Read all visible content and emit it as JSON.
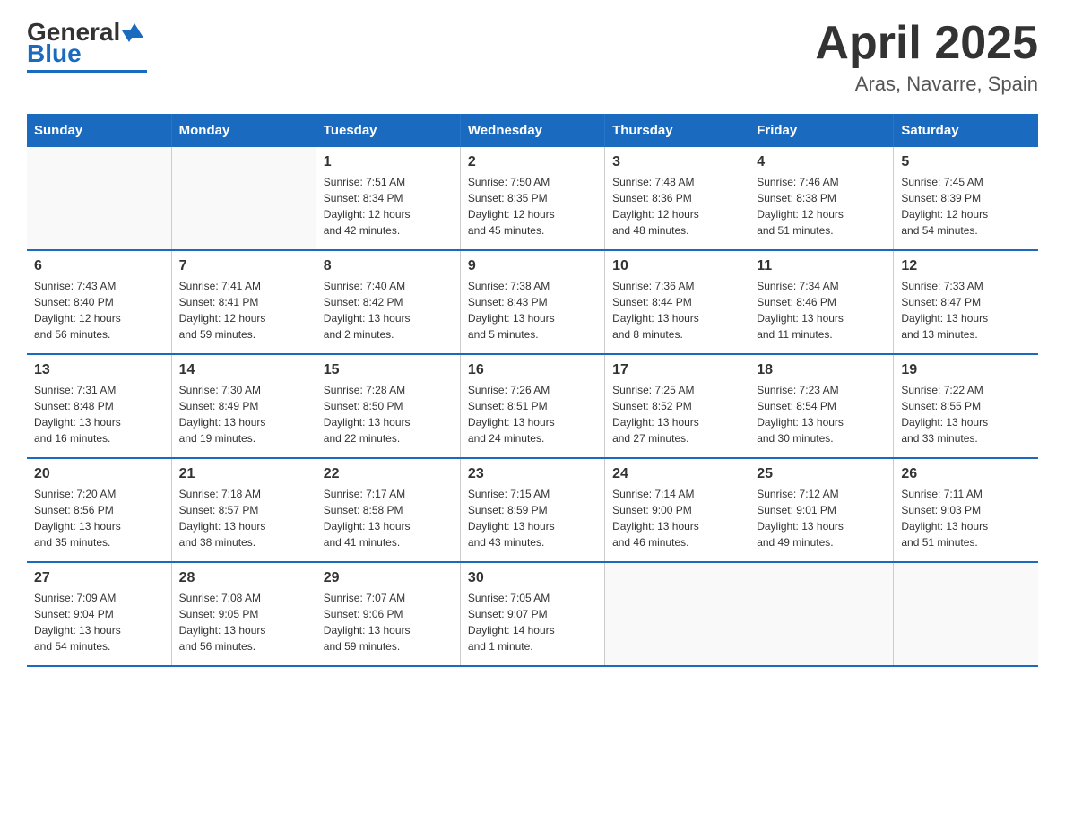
{
  "logo": {
    "general": "General",
    "blue": "Blue"
  },
  "title": {
    "month": "April 2025",
    "location": "Aras, Navarre, Spain"
  },
  "weekdays": [
    "Sunday",
    "Monday",
    "Tuesday",
    "Wednesday",
    "Thursday",
    "Friday",
    "Saturday"
  ],
  "weeks": [
    [
      {
        "day": "",
        "info": ""
      },
      {
        "day": "",
        "info": ""
      },
      {
        "day": "1",
        "info": "Sunrise: 7:51 AM\nSunset: 8:34 PM\nDaylight: 12 hours\nand 42 minutes."
      },
      {
        "day": "2",
        "info": "Sunrise: 7:50 AM\nSunset: 8:35 PM\nDaylight: 12 hours\nand 45 minutes."
      },
      {
        "day": "3",
        "info": "Sunrise: 7:48 AM\nSunset: 8:36 PM\nDaylight: 12 hours\nand 48 minutes."
      },
      {
        "day": "4",
        "info": "Sunrise: 7:46 AM\nSunset: 8:38 PM\nDaylight: 12 hours\nand 51 minutes."
      },
      {
        "day": "5",
        "info": "Sunrise: 7:45 AM\nSunset: 8:39 PM\nDaylight: 12 hours\nand 54 minutes."
      }
    ],
    [
      {
        "day": "6",
        "info": "Sunrise: 7:43 AM\nSunset: 8:40 PM\nDaylight: 12 hours\nand 56 minutes."
      },
      {
        "day": "7",
        "info": "Sunrise: 7:41 AM\nSunset: 8:41 PM\nDaylight: 12 hours\nand 59 minutes."
      },
      {
        "day": "8",
        "info": "Sunrise: 7:40 AM\nSunset: 8:42 PM\nDaylight: 13 hours\nand 2 minutes."
      },
      {
        "day": "9",
        "info": "Sunrise: 7:38 AM\nSunset: 8:43 PM\nDaylight: 13 hours\nand 5 minutes."
      },
      {
        "day": "10",
        "info": "Sunrise: 7:36 AM\nSunset: 8:44 PM\nDaylight: 13 hours\nand 8 minutes."
      },
      {
        "day": "11",
        "info": "Sunrise: 7:34 AM\nSunset: 8:46 PM\nDaylight: 13 hours\nand 11 minutes."
      },
      {
        "day": "12",
        "info": "Sunrise: 7:33 AM\nSunset: 8:47 PM\nDaylight: 13 hours\nand 13 minutes."
      }
    ],
    [
      {
        "day": "13",
        "info": "Sunrise: 7:31 AM\nSunset: 8:48 PM\nDaylight: 13 hours\nand 16 minutes."
      },
      {
        "day": "14",
        "info": "Sunrise: 7:30 AM\nSunset: 8:49 PM\nDaylight: 13 hours\nand 19 minutes."
      },
      {
        "day": "15",
        "info": "Sunrise: 7:28 AM\nSunset: 8:50 PM\nDaylight: 13 hours\nand 22 minutes."
      },
      {
        "day": "16",
        "info": "Sunrise: 7:26 AM\nSunset: 8:51 PM\nDaylight: 13 hours\nand 24 minutes."
      },
      {
        "day": "17",
        "info": "Sunrise: 7:25 AM\nSunset: 8:52 PM\nDaylight: 13 hours\nand 27 minutes."
      },
      {
        "day": "18",
        "info": "Sunrise: 7:23 AM\nSunset: 8:54 PM\nDaylight: 13 hours\nand 30 minutes."
      },
      {
        "day": "19",
        "info": "Sunrise: 7:22 AM\nSunset: 8:55 PM\nDaylight: 13 hours\nand 33 minutes."
      }
    ],
    [
      {
        "day": "20",
        "info": "Sunrise: 7:20 AM\nSunset: 8:56 PM\nDaylight: 13 hours\nand 35 minutes."
      },
      {
        "day": "21",
        "info": "Sunrise: 7:18 AM\nSunset: 8:57 PM\nDaylight: 13 hours\nand 38 minutes."
      },
      {
        "day": "22",
        "info": "Sunrise: 7:17 AM\nSunset: 8:58 PM\nDaylight: 13 hours\nand 41 minutes."
      },
      {
        "day": "23",
        "info": "Sunrise: 7:15 AM\nSunset: 8:59 PM\nDaylight: 13 hours\nand 43 minutes."
      },
      {
        "day": "24",
        "info": "Sunrise: 7:14 AM\nSunset: 9:00 PM\nDaylight: 13 hours\nand 46 minutes."
      },
      {
        "day": "25",
        "info": "Sunrise: 7:12 AM\nSunset: 9:01 PM\nDaylight: 13 hours\nand 49 minutes."
      },
      {
        "day": "26",
        "info": "Sunrise: 7:11 AM\nSunset: 9:03 PM\nDaylight: 13 hours\nand 51 minutes."
      }
    ],
    [
      {
        "day": "27",
        "info": "Sunrise: 7:09 AM\nSunset: 9:04 PM\nDaylight: 13 hours\nand 54 minutes."
      },
      {
        "day": "28",
        "info": "Sunrise: 7:08 AM\nSunset: 9:05 PM\nDaylight: 13 hours\nand 56 minutes."
      },
      {
        "day": "29",
        "info": "Sunrise: 7:07 AM\nSunset: 9:06 PM\nDaylight: 13 hours\nand 59 minutes."
      },
      {
        "day": "30",
        "info": "Sunrise: 7:05 AM\nSunset: 9:07 PM\nDaylight: 14 hours\nand 1 minute."
      },
      {
        "day": "",
        "info": ""
      },
      {
        "day": "",
        "info": ""
      },
      {
        "day": "",
        "info": ""
      }
    ]
  ]
}
